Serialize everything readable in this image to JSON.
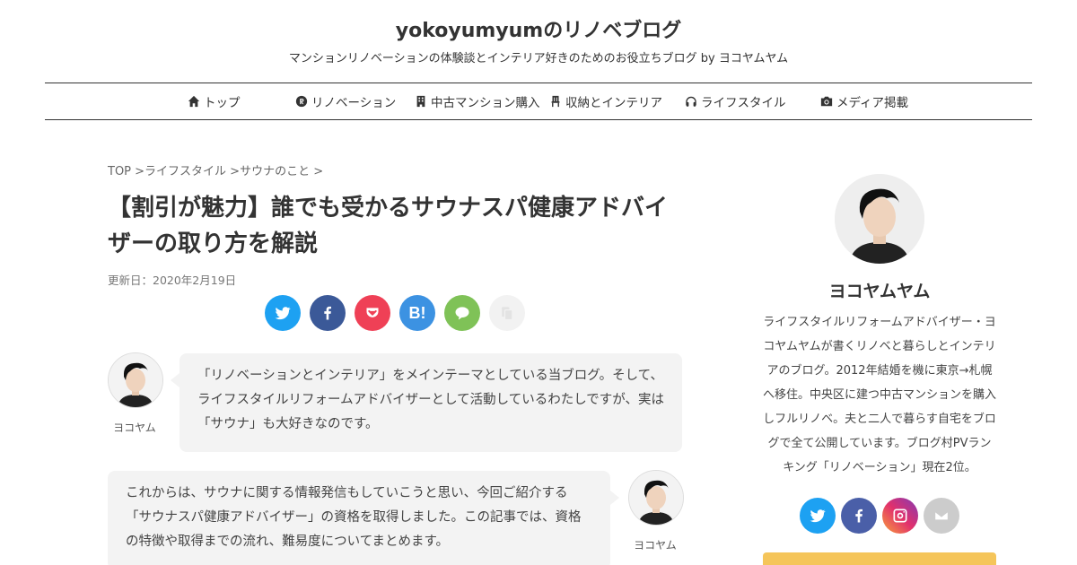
{
  "site": {
    "title": "yokoyumyumのリノベブログ",
    "description": "マンションリノベーションの体験談とインテリア好きのためのお役立ちブログ by ヨコヤムヤム"
  },
  "nav": {
    "items": [
      {
        "label": "トップ",
        "icon": "home-icon"
      },
      {
        "label": "リノベーション",
        "icon": "registered-icon"
      },
      {
        "label": "中古マンション購入",
        "icon": "building-icon"
      },
      {
        "label": "収納とインテリア",
        "icon": "chair-icon"
      },
      {
        "label": "ライフスタイル",
        "icon": "headphones-icon"
      },
      {
        "label": "メディア掲載",
        "icon": "camera-icon"
      }
    ]
  },
  "breadcrumb": [
    "TOP >",
    "ライフスタイル >",
    "サウナのこと >"
  ],
  "post": {
    "title": "【割引が魅力】誰でも受かるサウナスパ健康アドバイザーの取り方を解説",
    "date": "更新日：2020年2月19日"
  },
  "share": [
    {
      "icon": "twitter-icon",
      "color": "#1da1f2"
    },
    {
      "icon": "facebook-icon",
      "color": "#3b5998"
    },
    {
      "icon": "pocket-icon",
      "color": "#ef4056"
    },
    {
      "icon": "hatena-icon",
      "color": "#3c92e2",
      "label": "B!"
    },
    {
      "icon": "line-icon",
      "color": "#7fc257"
    },
    {
      "icon": "copy-icon",
      "color": "#f2f2f2"
    }
  ],
  "chat": [
    {
      "name": "ヨコヤム",
      "text": "「リノベーションとインテリア」をメインテーマとしている当ブログ。そして、ライフスタイルリフォームアドバイザーとして活動しているわたしですが、実は「サウナ」も大好きなのです。"
    },
    {
      "name": "ヨコヤム",
      "text": "これからは、サウナに関する情報発信もしていこうと思い、今回ご紹介する「サウナスパ健康アドバイザー」の資格を取得しました。この記事では、資格の特徴や取得までの流れ、難易度についてまとめます。"
    }
  ],
  "sidebar": {
    "name": "ヨコヤムヤム",
    "bio": "ライフスタイルリフォームアドバイザー・ヨコヤムヤムが書くリノベと暮らしとインテリアのブログ。2012年結婚を機に東京→札幌へ移住。中央区に建つ中古マンションを購入しフルリノベ。夫と二人で暮らす自宅をブログで全て公開しています。ブログ村PVランキング「リノベーション」現在2位。",
    "sns": [
      {
        "icon": "twitter-icon",
        "color": "#1da1f2"
      },
      {
        "icon": "facebook-icon",
        "color": "#4a5fa8"
      },
      {
        "icon": "instagram-icon",
        "color": "#c13584"
      },
      {
        "icon": "mail-icon",
        "color": "#cccccc"
      }
    ]
  }
}
